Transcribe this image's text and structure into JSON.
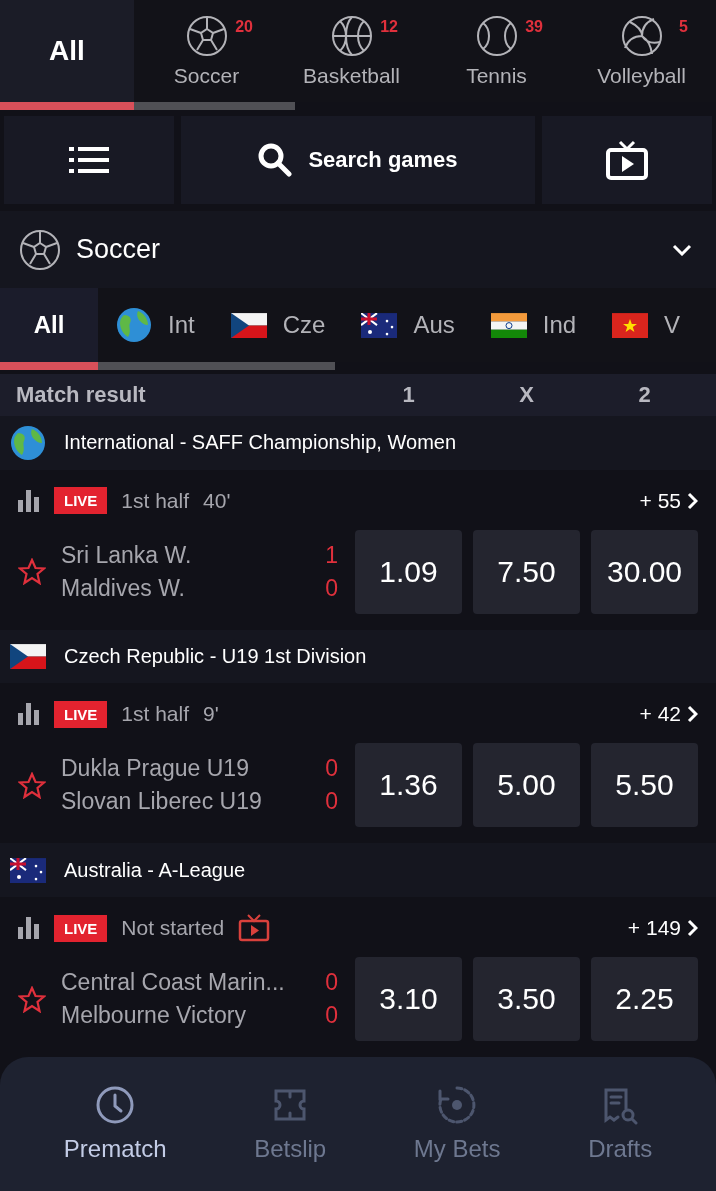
{
  "sports_tabs": [
    {
      "label": "All",
      "selected": true
    },
    {
      "label": "Soccer",
      "kind": "soccer",
      "count": "20",
      "selected": false
    },
    {
      "label": "Basketball",
      "kind": "basketball",
      "count": "12",
      "selected": false
    },
    {
      "label": "Tennis",
      "kind": "tennis",
      "count": "39",
      "selected": false
    },
    {
      "label": "Volleyball",
      "kind": "volleyball",
      "count": "5",
      "selected": false
    }
  ],
  "toolbar": {
    "search_label": "Search games"
  },
  "sport_header": {
    "label": "Soccer",
    "expanded": false
  },
  "country_tabs": [
    {
      "label": "All",
      "selected": true
    },
    {
      "label": "Int",
      "kind": "globe",
      "selected": false
    },
    {
      "label": "Cze",
      "kind": "cz",
      "selected": false
    },
    {
      "label": "Aus",
      "kind": "au",
      "selected": false
    },
    {
      "label": "Ind",
      "kind": "in",
      "selected": false
    },
    {
      "label": "V",
      "kind": "vn",
      "selected": false
    }
  ],
  "market_header": {
    "label": "Match result",
    "columns": [
      "1",
      "X",
      "2"
    ]
  },
  "leagues": [
    {
      "name": "International - SAFF Championship, Women",
      "kind": "globe",
      "matches": [
        {
          "badge": "LIVE",
          "status": "1st half",
          "minute": "40'",
          "tv": false,
          "more": "+ 55",
          "favorite": false,
          "teams": [
            {
              "name": "Sri Lanka W.",
              "score": "1"
            },
            {
              "name": "Maldives W.",
              "score": "0"
            }
          ],
          "odds": [
            "1.09",
            "7.50",
            "30.00"
          ]
        }
      ]
    },
    {
      "name": "Czech Republic - U19 1st Division",
      "kind": "cz",
      "matches": [
        {
          "badge": "LIVE",
          "status": "1st half",
          "minute": "9'",
          "tv": false,
          "more": "+ 42",
          "favorite": false,
          "teams": [
            {
              "name": "Dukla Prague U19",
              "score": "0"
            },
            {
              "name": "Slovan Liberec U19",
              "score": "0"
            }
          ],
          "odds": [
            "1.36",
            "5.00",
            "5.50"
          ]
        }
      ]
    },
    {
      "name": "Australia - A-League",
      "kind": "au",
      "matches": [
        {
          "badge": "LIVE",
          "status": "Not started",
          "tv": true,
          "more": "+ 149",
          "favorite": false,
          "teams": [
            {
              "name": "Central Coast Marin...",
              "score": "0"
            },
            {
              "name": "Melbourne Victory",
              "score": "0"
            }
          ],
          "odds": [
            "3.10",
            "3.50",
            "2.25"
          ]
        }
      ]
    }
  ],
  "bottom_nav": [
    {
      "label": "Prematch",
      "kind": "clock",
      "selected": true
    },
    {
      "label": "Betslip",
      "kind": "ticket",
      "selected": false
    },
    {
      "label": "My Bets",
      "kind": "history",
      "selected": false
    },
    {
      "label": "Drafts",
      "kind": "receipt-search",
      "selected": false
    }
  ]
}
